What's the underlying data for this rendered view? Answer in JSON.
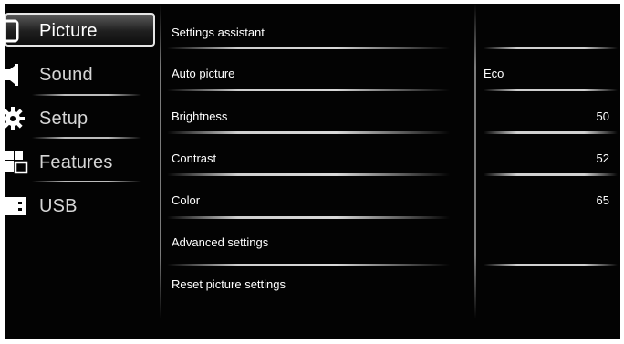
{
  "menu": {
    "items": [
      {
        "label": "Picture",
        "icon": "picture-icon",
        "selected": true
      },
      {
        "label": "Sound",
        "icon": "speaker-icon"
      },
      {
        "label": "Setup",
        "icon": "gear-icon"
      },
      {
        "label": "Features",
        "icon": "features-icon"
      },
      {
        "label": "USB",
        "icon": "usb-icon"
      }
    ]
  },
  "settings": [
    {
      "label": "Settings assistant",
      "value": ""
    },
    {
      "label": "Auto picture",
      "value": "Eco"
    },
    {
      "label": "Brightness",
      "value": "50"
    },
    {
      "label": "Contrast",
      "value": "52"
    },
    {
      "label": "Color",
      "value": "65"
    },
    {
      "label": "Advanced settings",
      "value": ""
    },
    {
      "label": "Reset picture settings",
      "value": ""
    }
  ],
  "colors": {
    "background": "#030303",
    "text": "#ffffff",
    "menu_text": "#d6d6d6",
    "separator": "#cfcfcf"
  }
}
